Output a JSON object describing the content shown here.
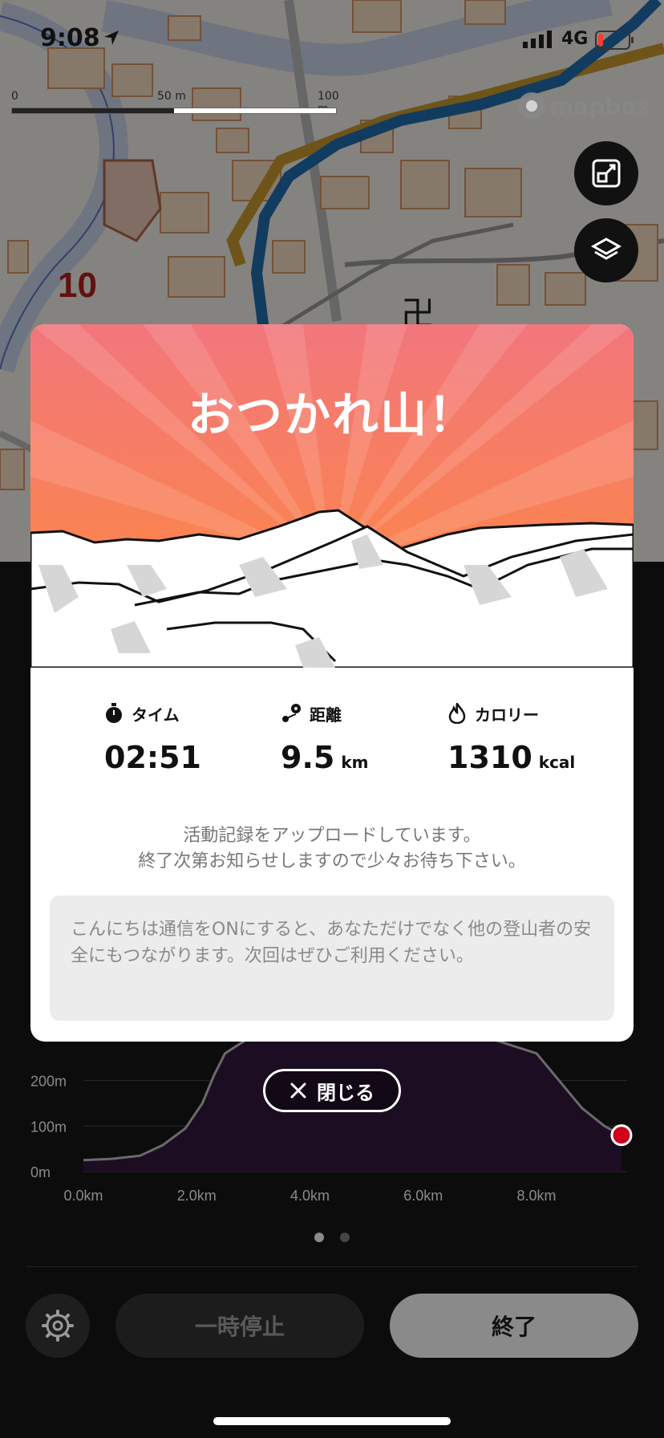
{
  "status_bar": {
    "time": "9:08",
    "network": "4G"
  },
  "map": {
    "scale_labels": [
      "0",
      "50 m",
      "100 m"
    ],
    "attribution": "mapbox",
    "area_number": "10"
  },
  "modal": {
    "title": "おつかれ山！",
    "stats": [
      {
        "label": "タイム",
        "value": "02:51",
        "unit": ""
      },
      {
        "label": "距離",
        "value": "9.5",
        "unit": "km"
      },
      {
        "label": "カロリー",
        "value": "1310",
        "unit": "kcal"
      }
    ],
    "upload_line1": "活動記録をアップロードしています。",
    "upload_line2": "終了次第お知らせしますので少々お待ち下さい。",
    "info": "こんにちは通信をONにすると、あなただけでなく他の登山者の安全にもつながります。次回はぜひご利用ください。",
    "close_label": "閉じる"
  },
  "chart_data": {
    "type": "area",
    "title": "",
    "xlabel": "",
    "ylabel": "",
    "x_ticks": [
      "0.0km",
      "2.0km",
      "4.0km",
      "6.0km",
      "8.0km"
    ],
    "y_ticks": [
      "0m",
      "100m",
      "200m"
    ],
    "xlim": [
      0,
      9.6
    ],
    "ylim": [
      0,
      300
    ],
    "x": [
      0,
      0.5,
      1.0,
      1.4,
      1.8,
      2.1,
      2.3,
      2.5,
      3.0,
      4.0,
      5.0,
      6.0,
      7.0,
      8.0,
      8.4,
      8.8,
      9.2,
      9.5
    ],
    "y": [
      25,
      28,
      35,
      58,
      95,
      150,
      210,
      260,
      300,
      300,
      300,
      300,
      300,
      260,
      200,
      140,
      100,
      80
    ],
    "marker_color": "#d0021b"
  },
  "controls": {
    "pause_label": "一時停止",
    "end_label": "終了",
    "page_count": 2,
    "active_page": 0
  },
  "colors": {
    "hero_top": "#f2767c",
    "hero_bottom": "#ff8a3a",
    "route": "#1f6db0",
    "panel": "#0c0c0c"
  }
}
